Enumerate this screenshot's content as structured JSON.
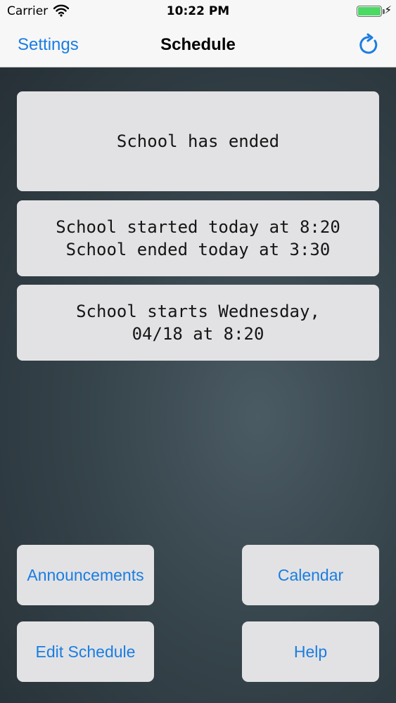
{
  "status_bar": {
    "carrier": "Carrier",
    "time": "10:22 PM",
    "wifi_icon": "wifi-icon",
    "battery_icon": "battery-icon",
    "charging_icon": "bolt-icon"
  },
  "nav": {
    "left_button": "Settings",
    "title": "Schedule",
    "right_icon": "refresh-icon",
    "accent": "#1a7de2"
  },
  "cards": {
    "status": "School has ended",
    "today_line1": "School started today at 8:20",
    "today_line2": "School ended today at 3:30",
    "next_line1": "School starts Wednesday,",
    "next_line2": "04/18 at 8:20"
  },
  "buttons": {
    "announcements": "Announcements",
    "calendar": "Calendar",
    "edit_schedule": "Edit Schedule",
    "help": "Help"
  }
}
